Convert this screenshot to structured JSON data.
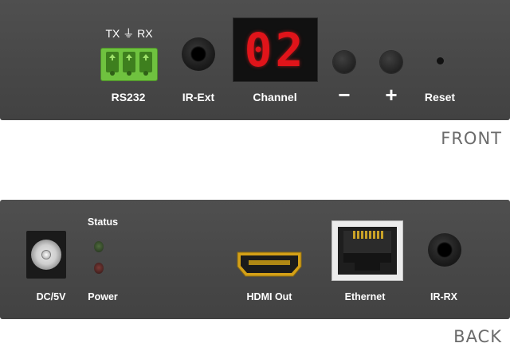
{
  "front": {
    "caption": "FRONT",
    "rs232": {
      "top_label": "TX ⏚ RX",
      "label": "RS232"
    },
    "ir_ext": {
      "label": "IR-Ext"
    },
    "channel": {
      "value": "02",
      "label": "Channel",
      "color": "#e0141a"
    },
    "minus": {
      "symbol": "−"
    },
    "plus": {
      "symbol": "+"
    },
    "reset": {
      "label": "Reset"
    },
    "terminal_color": "#6fc23f"
  },
  "back": {
    "caption": "BACK",
    "dc": {
      "label": "DC/5V"
    },
    "status": {
      "label": "Status"
    },
    "power": {
      "label": "Power"
    },
    "hdmi": {
      "label": "HDMI Out"
    },
    "ethernet": {
      "label": "Ethernet"
    },
    "ir_rx": {
      "label": "IR-RX"
    }
  },
  "panel_color": "#4a4a4a"
}
